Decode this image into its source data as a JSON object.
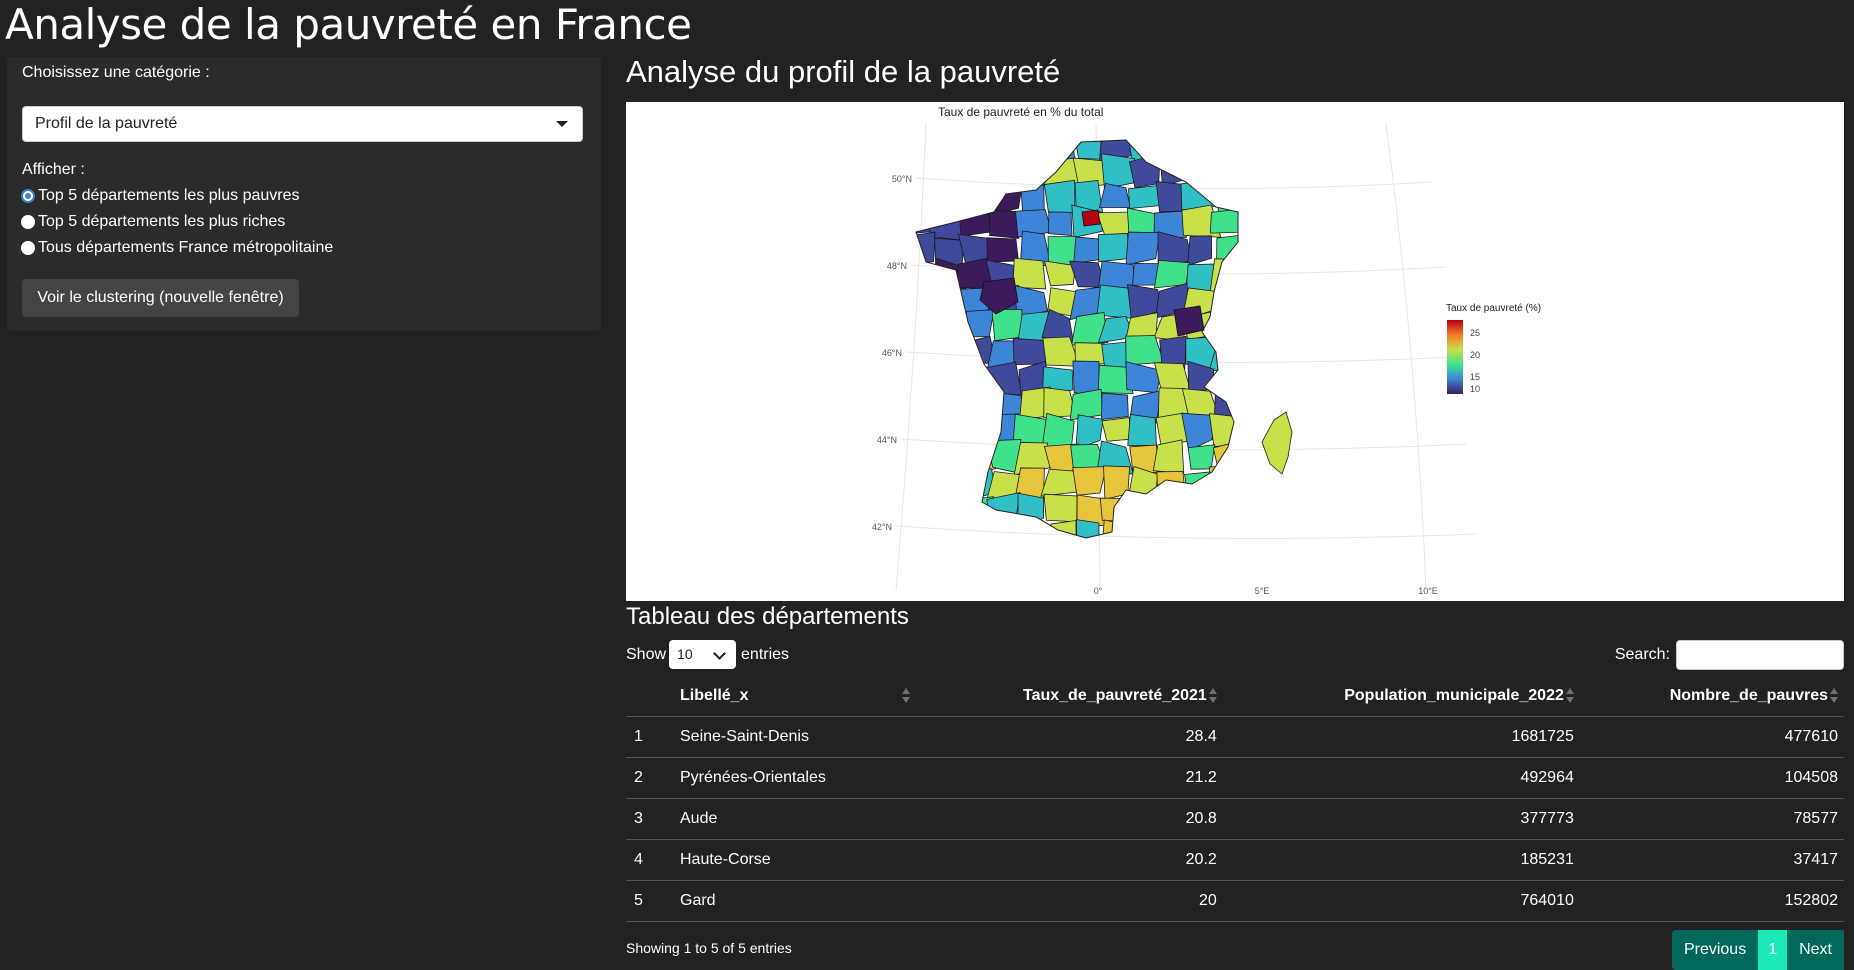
{
  "page": {
    "title": "Analyse de la pauvreté en France"
  },
  "sidebar": {
    "category_label": "Choisissez une catégorie :",
    "category_value": "Profil de la pauvreté",
    "display_label": "Afficher :",
    "options": [
      {
        "label": "Top 5 départements les plus pauvres",
        "checked": true
      },
      {
        "label": "Top 5 départements les plus riches",
        "checked": false
      },
      {
        "label": "Tous départements France métropolitaine",
        "checked": false
      }
    ],
    "cluster_button": "Voir le clustering (nouvelle fenêtre)"
  },
  "main": {
    "title": "Analyse du profil de la pauvreté",
    "map": {
      "title": "Taux de pauvreté en % du total",
      "lat_labels": [
        "50°N",
        "48°N",
        "46°N",
        "44°N",
        "42°N"
      ],
      "lon_labels": [
        "0°",
        "5°E",
        "10°E"
      ],
      "legend_title": "Taux de pauvreté (%)",
      "legend_ticks": [
        "25",
        "20",
        "15",
        "10"
      ],
      "colors": [
        "#3b1b5c",
        "#3f4a9a",
        "#3d85d6",
        "#2fbfc4",
        "#3fe28a",
        "#c8e04a",
        "#e6c43c",
        "#f47a2a",
        "#b5000f"
      ]
    },
    "table": {
      "title": "Tableau des départements",
      "show_label": "Show",
      "length_value": "10",
      "entries_label": "entries",
      "search_label": "Search:",
      "columns": [
        "",
        "Libellé_x",
        "Taux_de_pauvreté_2021",
        "Population_municipale_2022",
        "Nombre_de_pauvres"
      ],
      "rows": [
        [
          "1",
          "Seine-Saint-Denis",
          "28.4",
          "1681725",
          "477610"
        ],
        [
          "2",
          "Pyrénées-Orientales",
          "21.2",
          "492964",
          "104508"
        ],
        [
          "3",
          "Aude",
          "20.8",
          "377773",
          "78577"
        ],
        [
          "4",
          "Haute-Corse",
          "20.2",
          "185231",
          "37417"
        ],
        [
          "5",
          "Gard",
          "20",
          "764010",
          "152802"
        ]
      ],
      "info": "Showing 1 to 5 of 5 entries",
      "pager": {
        "previous": "Previous",
        "current": "1",
        "next": "Next"
      }
    }
  }
}
